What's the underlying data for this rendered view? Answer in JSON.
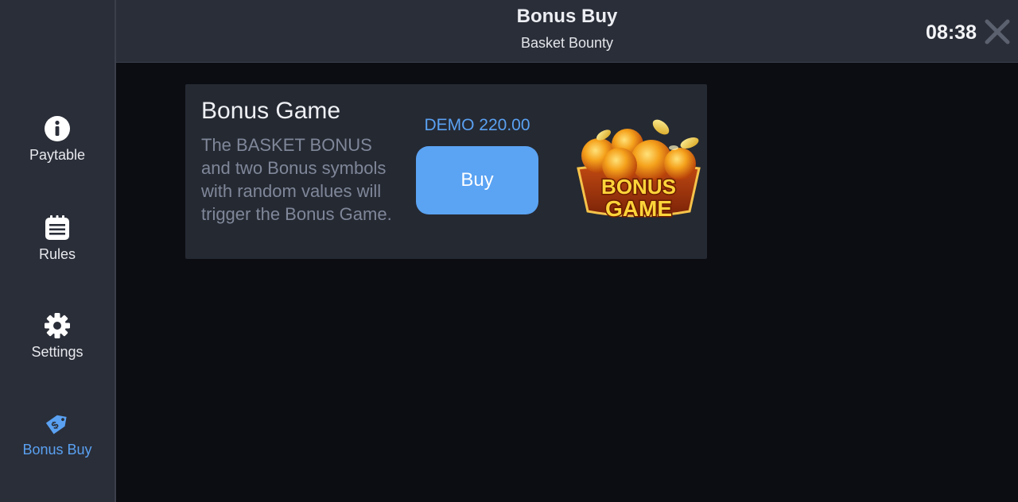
{
  "header": {
    "title": "Bonus Buy",
    "subtitle": "Basket Bounty",
    "clock": "08:38"
  },
  "sidebar": {
    "items": [
      {
        "label": "Paytable",
        "icon": "info-icon"
      },
      {
        "label": "Rules",
        "icon": "rules-list-icon"
      },
      {
        "label": "Settings",
        "icon": "gear-icon"
      },
      {
        "label": "Bonus Buy",
        "icon": "price-tag-icon",
        "active": true
      }
    ]
  },
  "bonus_card": {
    "title": "Bonus Game",
    "description": "The BASKET BONUS and two Bonus symbols with random values will trigger the Bonus Game.",
    "price": "DEMO 220.00",
    "buy_label": "Buy",
    "art_text_line1": "BONUS",
    "art_text_line2": "GAME"
  },
  "colors": {
    "accent": "#5aa1f2",
    "sidebar_bg": "#2a2e38",
    "card_bg": "#252932",
    "page_bg": "#0c0d12"
  }
}
